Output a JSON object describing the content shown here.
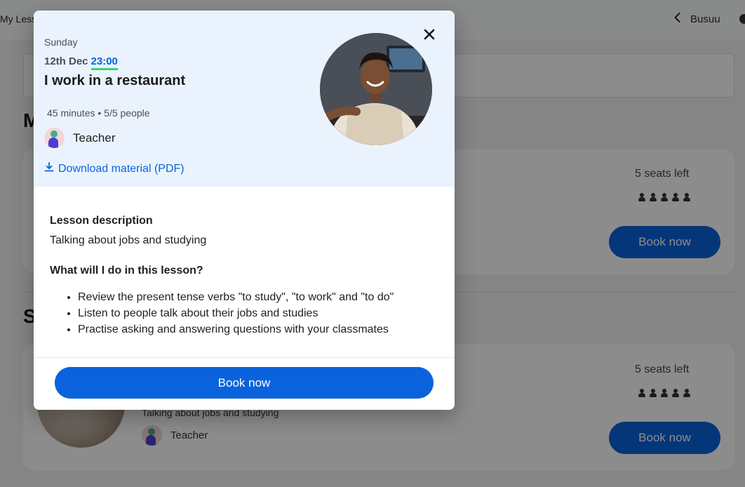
{
  "topbar": {
    "breadcrumb": "My Less",
    "back_label": "Busuu"
  },
  "background": {
    "section_1_heading": "M",
    "section_2_heading": "S",
    "cards": [
      {
        "seats_left": "5 seats left",
        "book_label": "Book now"
      },
      {
        "seats_left": "5 seats left",
        "book_label": "Book now",
        "description": "Talking about jobs and studying",
        "teacher": "Teacher"
      }
    ]
  },
  "modal": {
    "day": "Sunday",
    "date": "12th Dec",
    "time": "23:00",
    "title": "I work in a restaurant",
    "meta": "45 minutes • 5/5 people",
    "teacher": "Teacher",
    "download_label": "Download material (PDF)",
    "description_heading": "Lesson description",
    "description": "Talking about jobs and studying",
    "what_heading": "What will I do in this lesson?",
    "activities": [
      "Review the present tense verbs \"to study\", \"to work\" and \"to do\"",
      "Listen to people talk about their jobs and studies",
      "Practise asking and answering questions with your classmates"
    ],
    "book_label": "Book now"
  },
  "colors": {
    "accent": "#0a63dd",
    "underline": "#3bd36b",
    "modal_header_bg": "#eaf3fd"
  }
}
